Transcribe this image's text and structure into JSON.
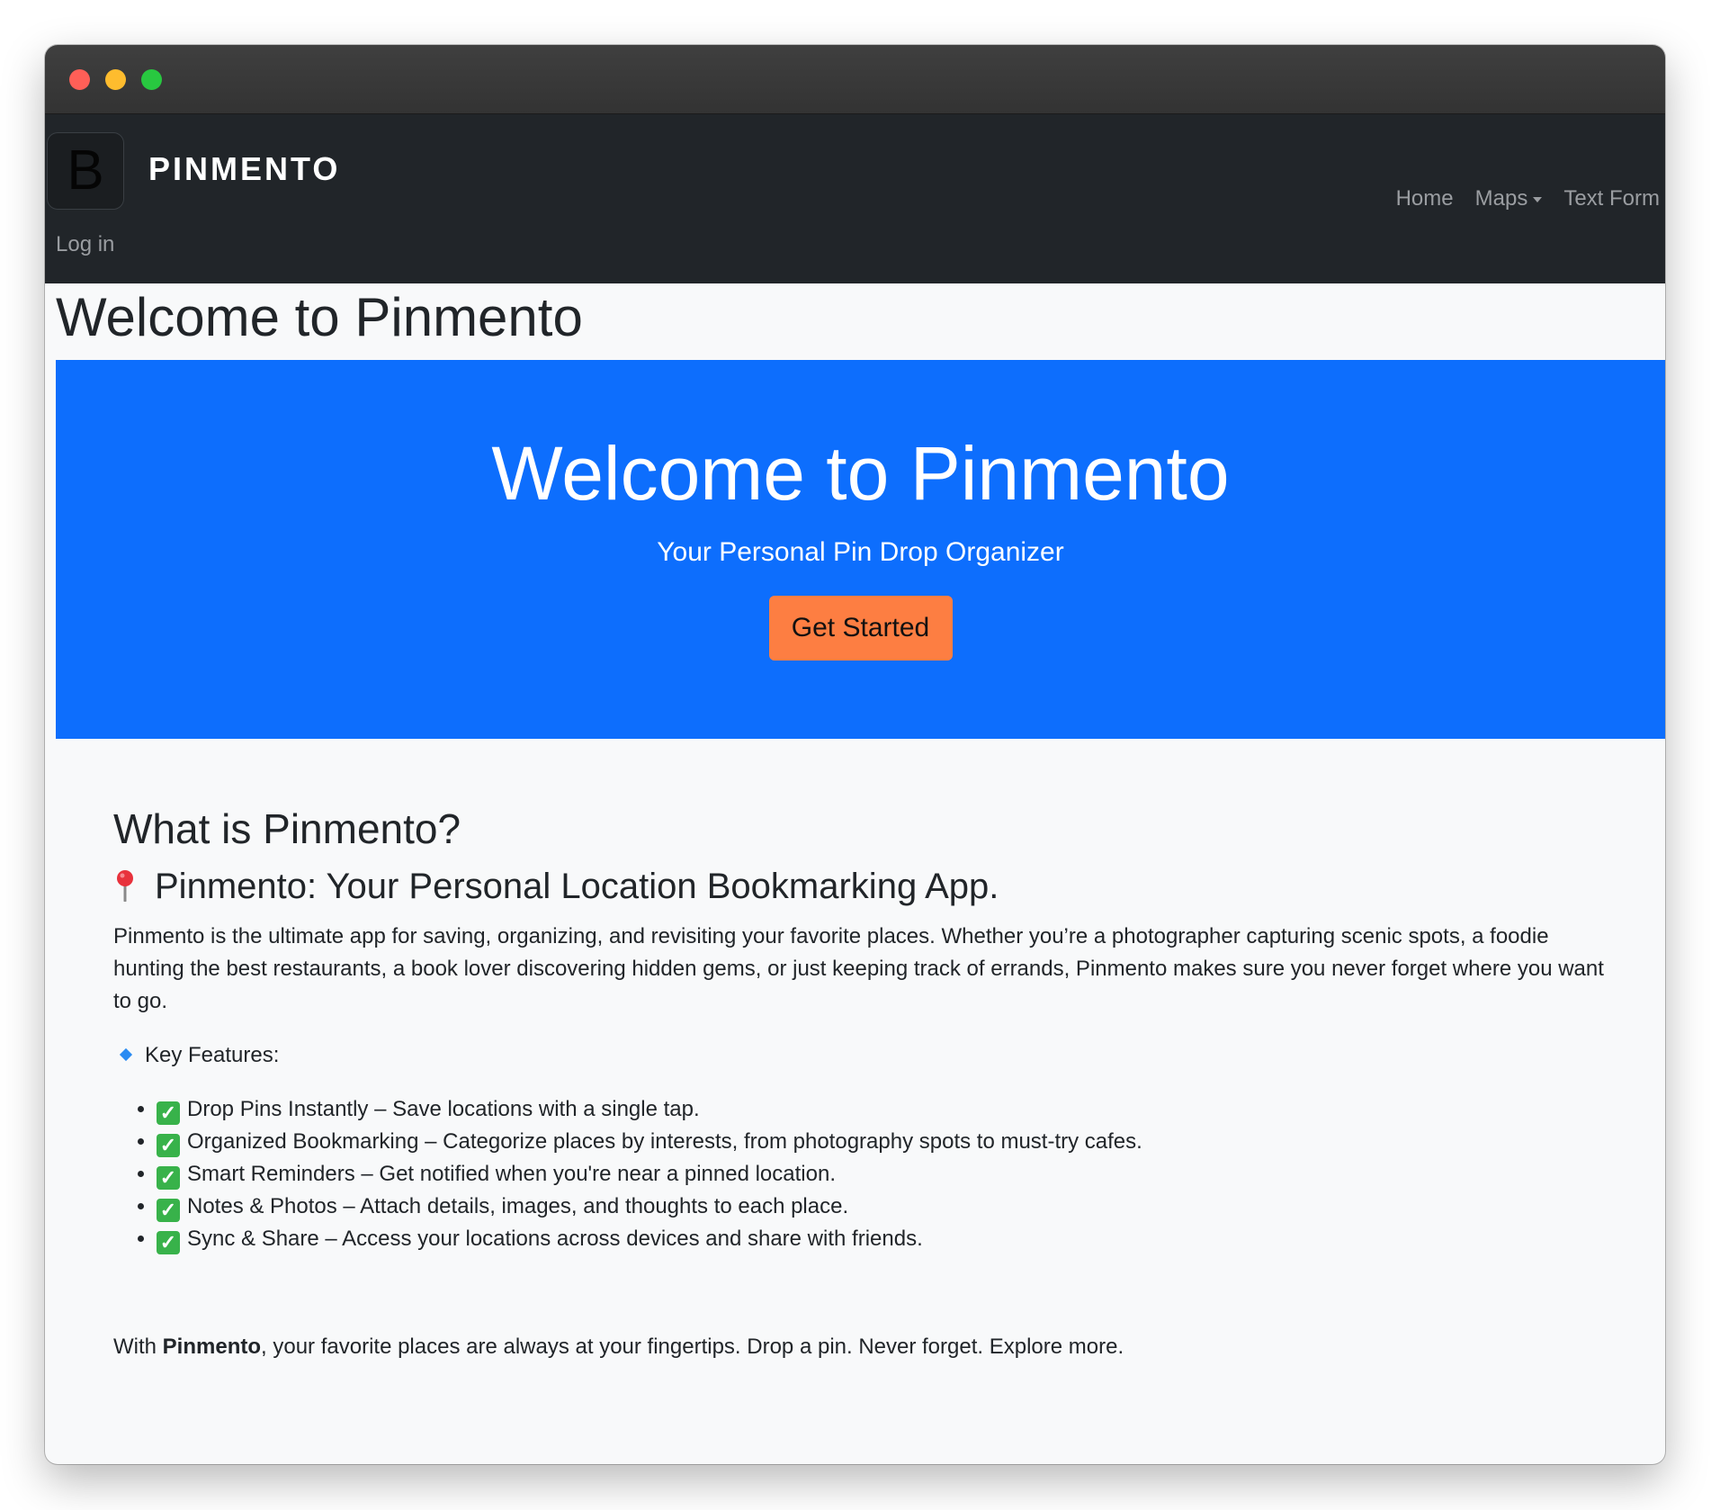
{
  "navbar": {
    "logo_letter": "B",
    "brand": "PINMENTO",
    "links": [
      {
        "label": "Home"
      },
      {
        "label": "Maps"
      },
      {
        "label": "Text Form"
      }
    ],
    "login": "Log in"
  },
  "page": {
    "title": "Welcome to Pinmento"
  },
  "hero": {
    "title": "Welcome to Pinmento",
    "subtitle": "Your Personal Pin Drop Organizer",
    "button": "Get Started",
    "background_color": "#0d6efd",
    "button_color": "#fd7e42"
  },
  "about": {
    "heading": "What is Pinmento?",
    "subheading": "Pinmento: Your Personal Location Bookmarking App.",
    "intro": "Pinmento is the ultimate app for saving, organizing, and revisiting your favorite places. Whether you’re a photographer capturing scenic spots, a foodie hunting the best restaurants, a book lover discovering hidden gems, or just keeping track of errands, Pinmento makes sure you never forget where you want to go.",
    "features_heading": "Key Features:",
    "features": [
      {
        "text": "Drop Pins Instantly – Save locations with a single tap."
      },
      {
        "text": "Organized Bookmarking – Categorize places by interests, from photography spots to must-try cafes."
      },
      {
        "text": "Smart Reminders – Get notified when you're near a pinned location."
      },
      {
        "text": "Notes & Photos – Attach details, images, and thoughts to each place."
      },
      {
        "text": "Sync & Share – Access your locations across devices and share with friends."
      }
    ],
    "closing_prefix": "With ",
    "closing_brand": "Pinmento",
    "closing_suffix": ", your favorite places are always at your fingertips. Drop a pin. Never forget. Explore more."
  },
  "icons": {
    "pin": "round-pushpin-icon",
    "diamond": "small-blue-diamond-icon",
    "check": "check-mark-button-icon"
  }
}
